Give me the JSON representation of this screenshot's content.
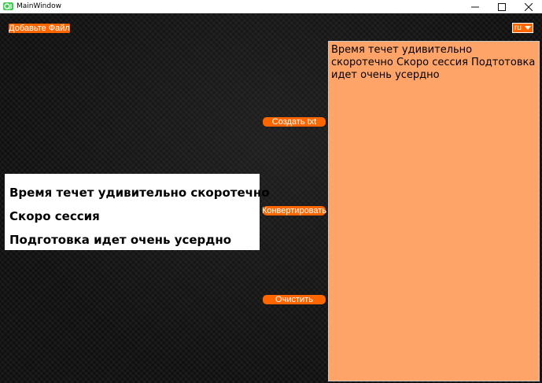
{
  "window": {
    "title": "MainWindow",
    "controls": {
      "minimize_icon": "minimize-icon",
      "maximize_icon": "maximize-icon",
      "close_icon": "close-icon"
    }
  },
  "toolbar": {
    "add_file_label": "Добавьте Файл",
    "language": {
      "selected": "ru",
      "arrow_icon": "chevron-down-icon"
    }
  },
  "image_preview": {
    "lines": [
      "Время течет удивительно скоротечно",
      "Скоро сессия",
      "Подготовка идет очень усердно"
    ]
  },
  "actions": {
    "create_txt_label": "Создать txt",
    "convert_label": "Конвертировать",
    "clear_label": "Очистить"
  },
  "output": {
    "text": "Время течет удивительно скоротечно Скоро сессия Подтотовка идет очень усердно"
  },
  "colors": {
    "accent": "#ff6600",
    "output_background": "#ffa468",
    "window_background": "#151515"
  }
}
